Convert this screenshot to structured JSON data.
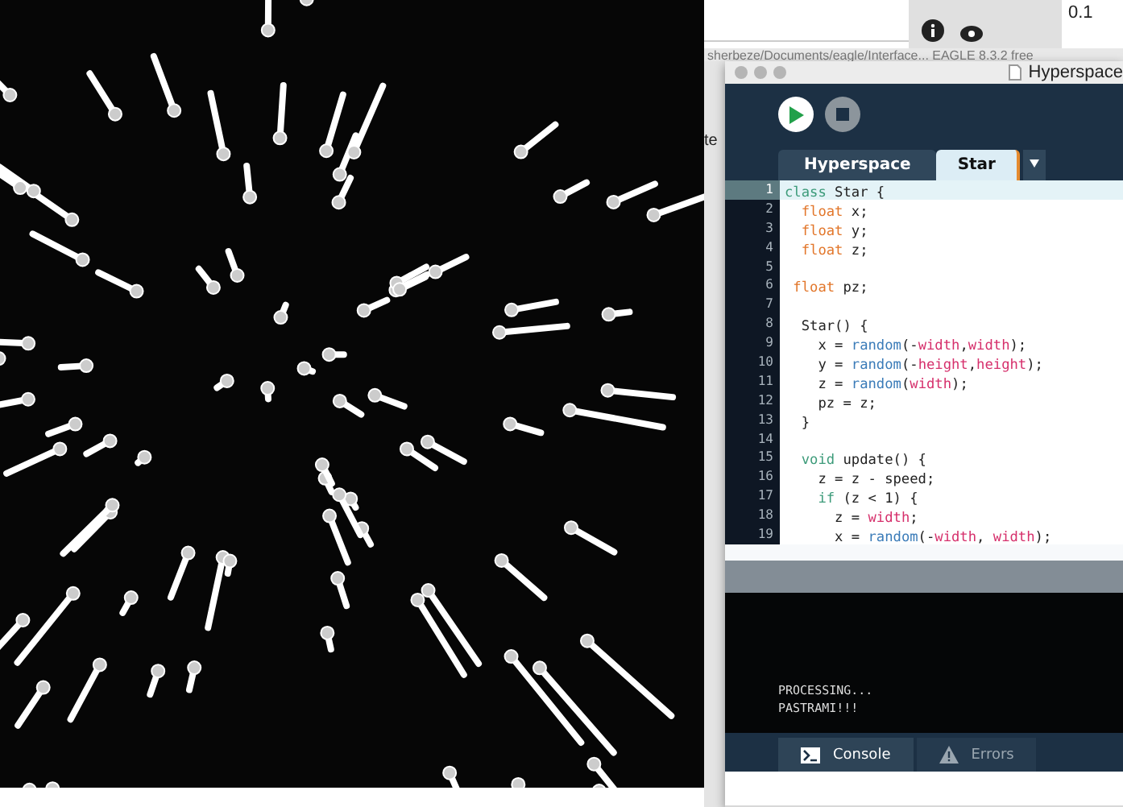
{
  "background_window": {
    "side_label": "te",
    "path_title": "sherbeze/Documents/eagle/Interface... EAGLE 8.3.2 free",
    "corner_value": "0.1"
  },
  "window": {
    "title": "Hyperspace"
  },
  "tabs": [
    {
      "label": "Hyperspace",
      "selected": false
    },
    {
      "label": "Star",
      "selected": true
    }
  ],
  "editor": {
    "lines": [
      {
        "number": "1",
        "current": true,
        "tokens": [
          {
            "text": "class",
            "kind": "keyword"
          },
          {
            "text": " Star {",
            "kind": "plain"
          }
        ]
      },
      {
        "number": "2",
        "current": false,
        "tokens": [
          {
            "text": "  float",
            "kind": "type"
          },
          {
            "text": " x;",
            "kind": "plain"
          }
        ]
      },
      {
        "number": "3",
        "current": false,
        "tokens": [
          {
            "text": "  float",
            "kind": "type"
          },
          {
            "text": " y;",
            "kind": "plain"
          }
        ]
      },
      {
        "number": "4",
        "current": false,
        "tokens": [
          {
            "text": "  float",
            "kind": "type"
          },
          {
            "text": " z;",
            "kind": "plain"
          }
        ]
      },
      {
        "number": "5",
        "current": false
      },
      {
        "number": "6",
        "current": false,
        "tokens": [
          {
            "text": " float",
            "kind": "type"
          },
          {
            "text": " pz;",
            "kind": "plain"
          }
        ]
      },
      {
        "number": "7",
        "current": false
      },
      {
        "number": "8",
        "current": false,
        "tokens": [
          {
            "text": "  Star() {",
            "kind": "plain"
          }
        ]
      },
      {
        "number": "9",
        "current": false,
        "tokens": [
          {
            "text": "    x = ",
            "kind": "plain"
          },
          {
            "text": "random",
            "kind": "function"
          },
          {
            "text": "(-",
            "kind": "plain"
          },
          {
            "text": "width",
            "kind": "constant"
          },
          {
            "text": ",",
            "kind": "plain"
          },
          {
            "text": "width",
            "kind": "constant"
          },
          {
            "text": ");",
            "kind": "plain"
          }
        ]
      },
      {
        "number": "10",
        "current": false,
        "tokens": [
          {
            "text": "    y = ",
            "kind": "plain"
          },
          {
            "text": "random",
            "kind": "function"
          },
          {
            "text": "(-",
            "kind": "plain"
          },
          {
            "text": "height",
            "kind": "constant"
          },
          {
            "text": ",",
            "kind": "plain"
          },
          {
            "text": "height",
            "kind": "constant"
          },
          {
            "text": ");",
            "kind": "plain"
          }
        ]
      },
      {
        "number": "11",
        "current": false,
        "tokens": [
          {
            "text": "    z = ",
            "kind": "plain"
          },
          {
            "text": "random",
            "kind": "function"
          },
          {
            "text": "(",
            "kind": "plain"
          },
          {
            "text": "width",
            "kind": "constant"
          },
          {
            "text": ");",
            "kind": "plain"
          }
        ]
      },
      {
        "number": "12",
        "current": false,
        "tokens": [
          {
            "text": "    pz = z;",
            "kind": "plain"
          }
        ]
      },
      {
        "number": "13",
        "current": false,
        "tokens": [
          {
            "text": "  }",
            "kind": "plain"
          }
        ]
      },
      {
        "number": "14",
        "current": false
      },
      {
        "number": "15",
        "current": false,
        "tokens": [
          {
            "text": "  void",
            "kind": "keyword"
          },
          {
            "text": " update() {",
            "kind": "plain"
          }
        ]
      },
      {
        "number": "16",
        "current": false,
        "tokens": [
          {
            "text": "    z = z - speed;",
            "kind": "plain"
          }
        ]
      },
      {
        "number": "17",
        "current": false,
        "tokens": [
          {
            "text": "    if",
            "kind": "keyword"
          },
          {
            "text": " (z < 1) {",
            "kind": "plain"
          }
        ]
      },
      {
        "number": "18",
        "current": false,
        "tokens": [
          {
            "text": "      z = ",
            "kind": "plain"
          },
          {
            "text": "width",
            "kind": "constant"
          },
          {
            "text": ";",
            "kind": "plain"
          }
        ]
      },
      {
        "number": "19",
        "current": false,
        "tokens": [
          {
            "text": "      x = ",
            "kind": "plain"
          },
          {
            "text": "random",
            "kind": "function"
          },
          {
            "text": "(-",
            "kind": "plain"
          },
          {
            "text": "width",
            "kind": "constant"
          },
          {
            "text": ", ",
            "kind": "plain"
          },
          {
            "text": "width",
            "kind": "constant"
          },
          {
            "text": ");",
            "kind": "plain"
          }
        ]
      }
    ]
  },
  "console": {
    "lines": [
      "PROCESSING...",
      "PASTRAMI!!!"
    ]
  },
  "bottom_tabs": [
    {
      "label": "Console",
      "kind": "console",
      "selected": true
    },
    {
      "label": "Errors",
      "kind": "errors",
      "selected": false
    }
  ]
}
